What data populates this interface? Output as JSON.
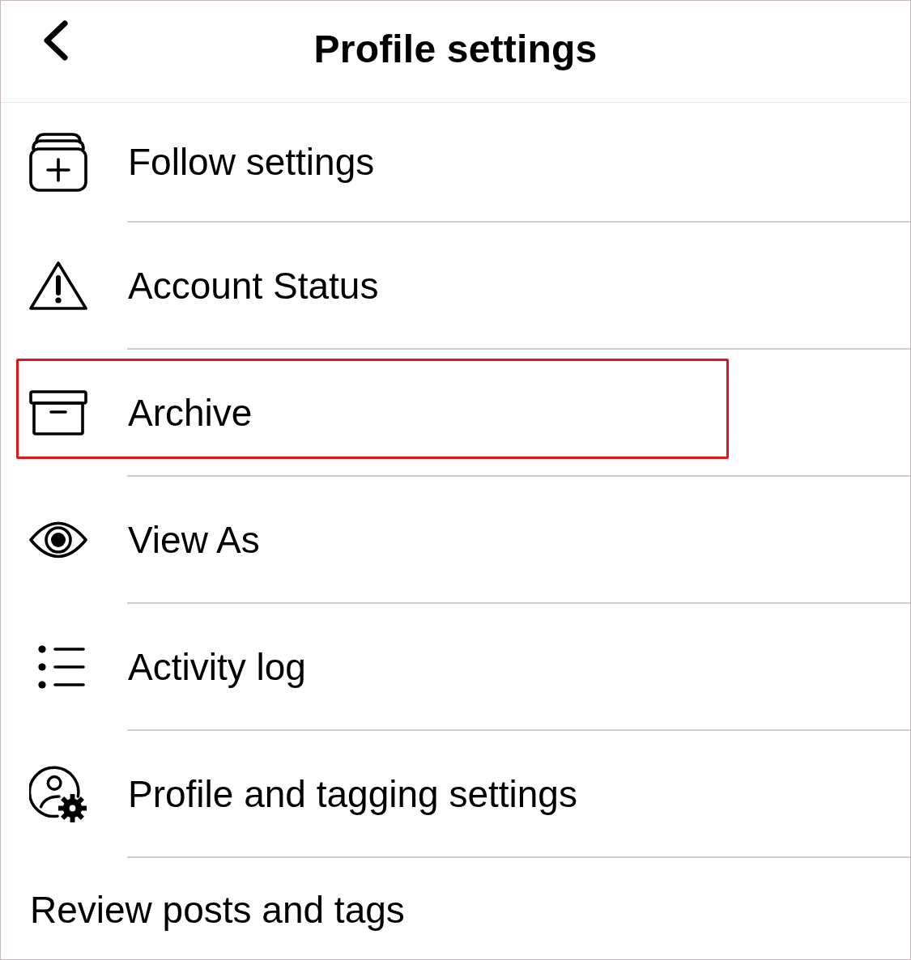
{
  "header": {
    "title": "Profile settings"
  },
  "items": [
    {
      "kind": "icon",
      "label": "Follow settings",
      "highlighted": false
    },
    {
      "kind": "icon",
      "label": "Account Status",
      "highlighted": false
    },
    {
      "kind": "icon",
      "label": "Archive",
      "highlighted": true
    },
    {
      "kind": "icon",
      "label": "View As",
      "highlighted": false
    },
    {
      "kind": "icon",
      "label": "Activity log",
      "highlighted": false
    },
    {
      "kind": "icon",
      "label": "Profile and tagging settings",
      "highlighted": false
    },
    {
      "kind": "text",
      "label": "Review posts and tags",
      "highlighted": false
    }
  ]
}
